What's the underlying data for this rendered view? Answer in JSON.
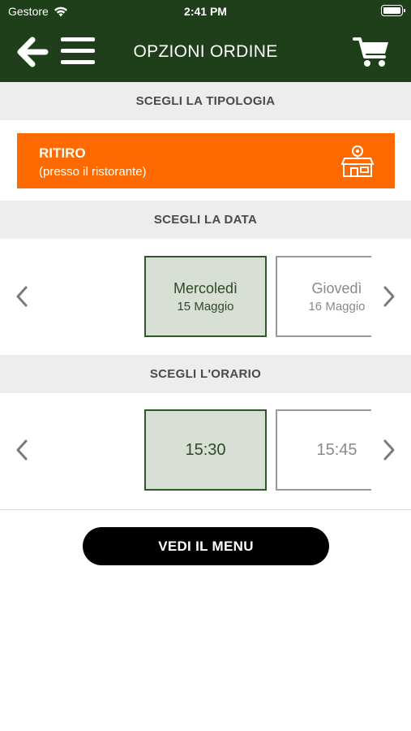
{
  "status_bar": {
    "carrier": "Gestore",
    "time": "2:41 PM"
  },
  "header": {
    "title": "OPZIONI ORDINE",
    "back_icon": "arrow-left-icon",
    "menu_icon": "hamburger-icon",
    "cart_icon": "cart-icon"
  },
  "sections": {
    "tipologia": "SCEGLI LA TIPOLOGIA",
    "data": "SCEGLI LA DATA",
    "orario": "SCEGLI L'ORARIO"
  },
  "order_type": {
    "title": "RITIRO",
    "subtitle": "(presso il ristorante)",
    "icon": "store-location-icon",
    "color": "#ff6a00"
  },
  "dates": [
    {
      "day": "Mercoledì",
      "date": "15 Maggio",
      "selected": true
    },
    {
      "day": "Giovedì",
      "date": "16 Maggio",
      "selected": false
    }
  ],
  "times": [
    {
      "time": "15:30",
      "selected": true
    },
    {
      "time": "15:45",
      "selected": false
    }
  ],
  "menu_button": {
    "label": "VEDI IL MENU"
  },
  "colors": {
    "header_bg": "#1f3f1a",
    "accent": "#ff6a00",
    "selected_bg": "#d8e0d6",
    "selected_border": "#2d5a27"
  }
}
